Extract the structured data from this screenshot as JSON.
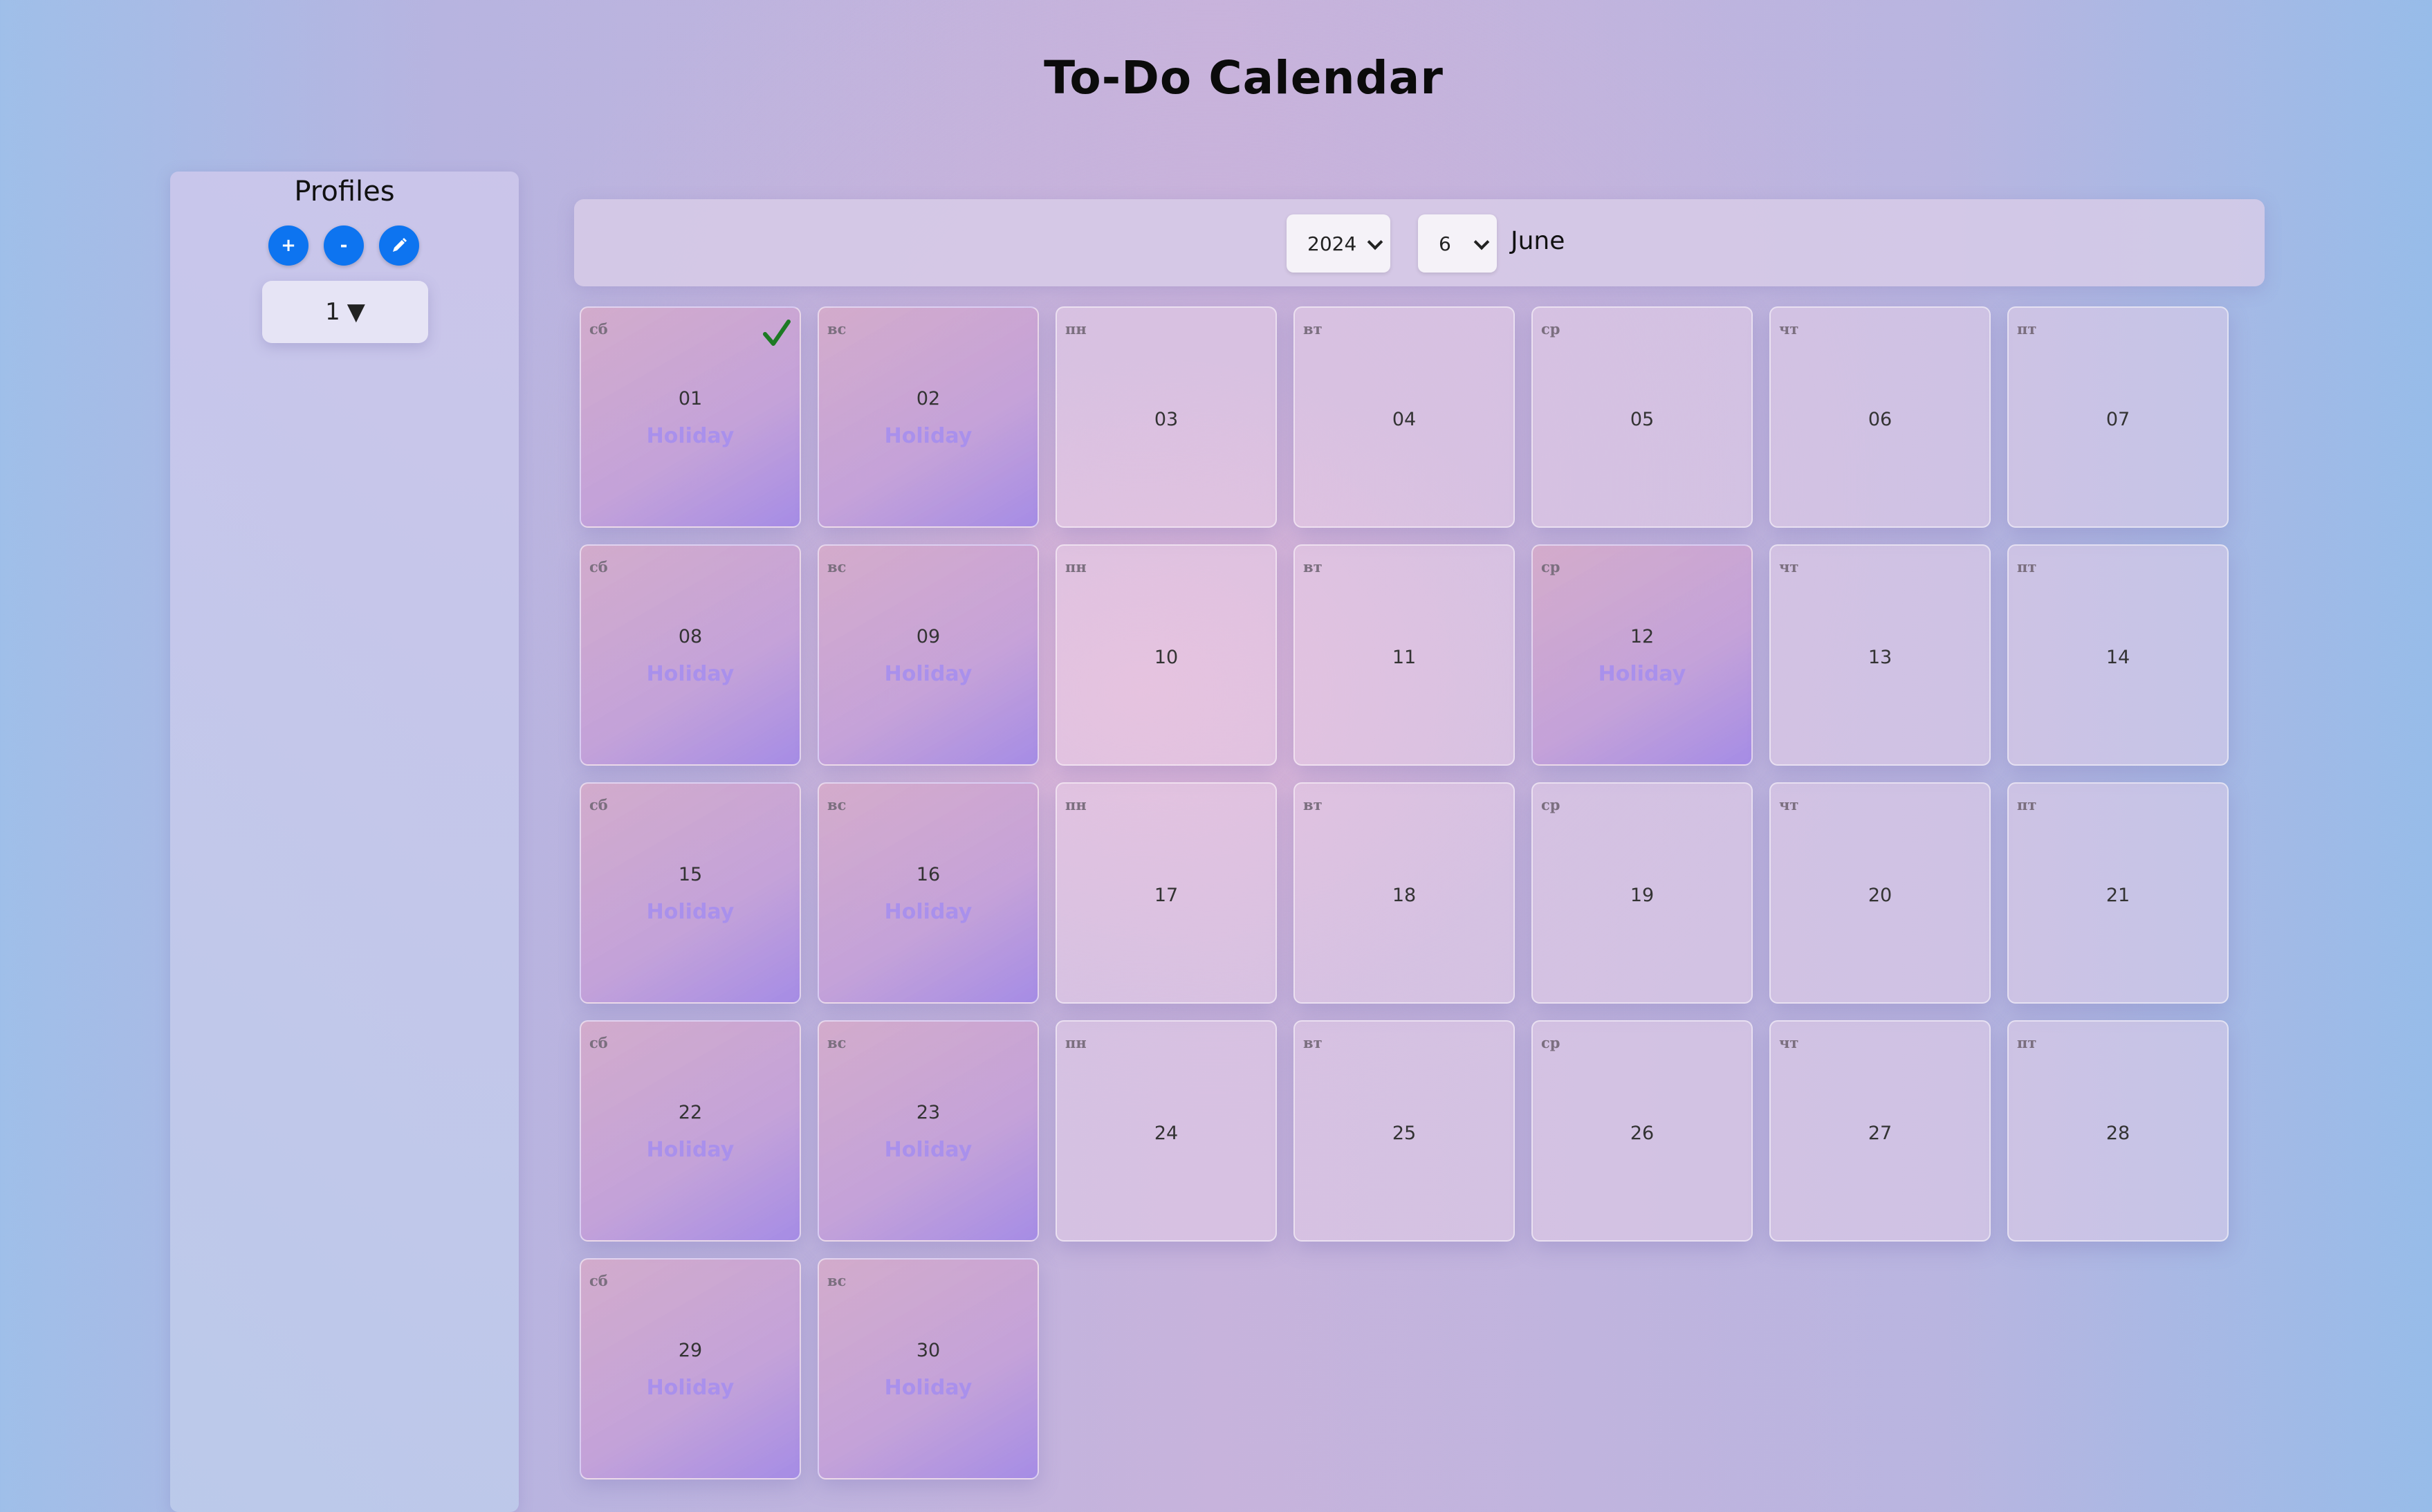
{
  "app": {
    "title": "To-Do Calendar"
  },
  "profiles": {
    "title": "Profiles",
    "add_label": "+",
    "remove_label": "-",
    "current": "1",
    "dropdown_arrow": "▼"
  },
  "controls": {
    "year": "2024",
    "month_number": "6",
    "month_name": "June"
  },
  "colors": {
    "button_blue": "#0d74f0",
    "holiday_text": "#a990ec",
    "check_green": "#1d7a24"
  },
  "holiday_label": "Holiday",
  "days": [
    {
      "dow": "сб",
      "num": "01",
      "holiday": true,
      "checked": true
    },
    {
      "dow": "вс",
      "num": "02",
      "holiday": true
    },
    {
      "dow": "пн",
      "num": "03",
      "holiday": false
    },
    {
      "dow": "вт",
      "num": "04",
      "holiday": false
    },
    {
      "dow": "ср",
      "num": "05",
      "holiday": false
    },
    {
      "dow": "чт",
      "num": "06",
      "holiday": false
    },
    {
      "dow": "пт",
      "num": "07",
      "holiday": false
    },
    {
      "dow": "сб",
      "num": "08",
      "holiday": true
    },
    {
      "dow": "вс",
      "num": "09",
      "holiday": true
    },
    {
      "dow": "пн",
      "num": "10",
      "holiday": false
    },
    {
      "dow": "вт",
      "num": "11",
      "holiday": false
    },
    {
      "dow": "ср",
      "num": "12",
      "holiday": true
    },
    {
      "dow": "чт",
      "num": "13",
      "holiday": false
    },
    {
      "dow": "пт",
      "num": "14",
      "holiday": false
    },
    {
      "dow": "сб",
      "num": "15",
      "holiday": true
    },
    {
      "dow": "вс",
      "num": "16",
      "holiday": true
    },
    {
      "dow": "пн",
      "num": "17",
      "holiday": false
    },
    {
      "dow": "вт",
      "num": "18",
      "holiday": false
    },
    {
      "dow": "ср",
      "num": "19",
      "holiday": false
    },
    {
      "dow": "чт",
      "num": "20",
      "holiday": false
    },
    {
      "dow": "пт",
      "num": "21",
      "holiday": false
    },
    {
      "dow": "сб",
      "num": "22",
      "holiday": true
    },
    {
      "dow": "вс",
      "num": "23",
      "holiday": true
    },
    {
      "dow": "пн",
      "num": "24",
      "holiday": false
    },
    {
      "dow": "вт",
      "num": "25",
      "holiday": false
    },
    {
      "dow": "ср",
      "num": "26",
      "holiday": false
    },
    {
      "dow": "чт",
      "num": "27",
      "holiday": false
    },
    {
      "dow": "пт",
      "num": "28",
      "holiday": false
    },
    {
      "dow": "сб",
      "num": "29",
      "holiday": true
    },
    {
      "dow": "вс",
      "num": "30",
      "holiday": true
    }
  ]
}
